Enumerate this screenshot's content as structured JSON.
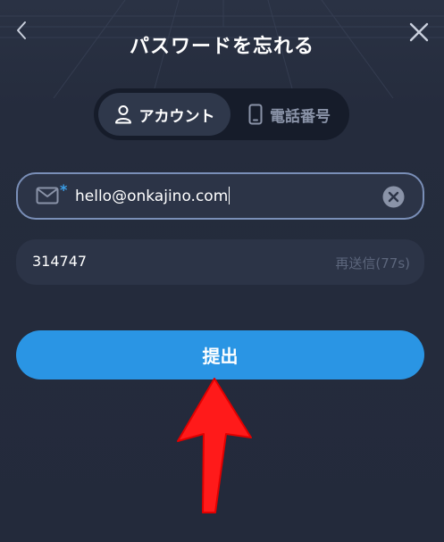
{
  "header": {
    "title": "パスワードを忘れる",
    "back_icon": "chevron-left-icon",
    "close_icon": "close-icon"
  },
  "tabs": [
    {
      "label": "アカウント",
      "icon": "user-icon",
      "active": true
    },
    {
      "label": "電話番号",
      "icon": "phone-icon",
      "active": false
    }
  ],
  "email_field": {
    "value": "hello@onkajino.com",
    "required_mark": "*",
    "icon": "mail-icon",
    "clear_icon": "clear-icon"
  },
  "code_field": {
    "value": "314747",
    "resend_label": "再送信(77s)"
  },
  "submit": {
    "label": "提出"
  },
  "colors": {
    "background": "#232a3b",
    "accent": "#2a95e4",
    "field_bg": "#2c3447",
    "arrow": "#ff1a1a"
  }
}
